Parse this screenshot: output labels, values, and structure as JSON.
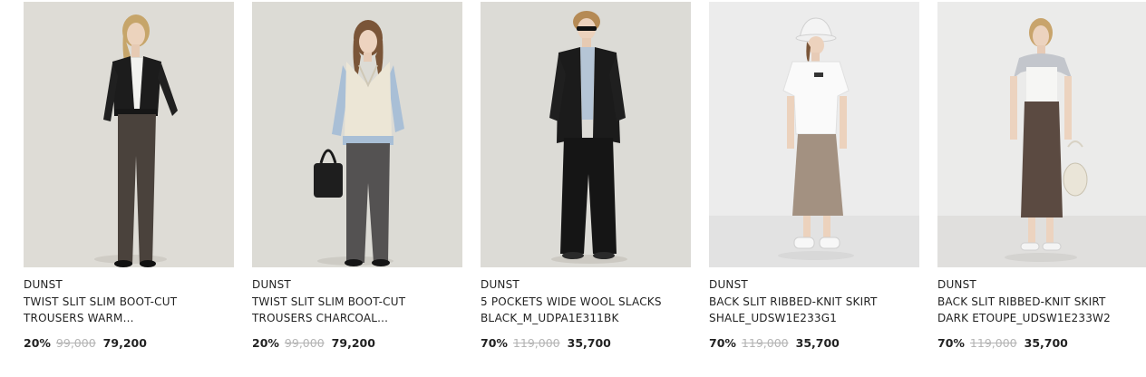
{
  "products": [
    {
      "brand": "DUNST",
      "name": "TWIST SLIT SLIM BOOT-CUT\nTROUSERS WARM...",
      "discount": "20%",
      "original_price": "99,000",
      "sale_price": "79,200",
      "image_icon": "model-black-jacket-grey-trousers"
    },
    {
      "brand": "DUNST",
      "name": "TWIST SLIT SLIM BOOT-CUT\nTROUSERS CHARCOAL...",
      "discount": "20%",
      "original_price": "99,000",
      "sale_price": "79,200",
      "image_icon": "model-knit-vest-charcoal-trousers"
    },
    {
      "brand": "DUNST",
      "name": "5 POCKETS WIDE WOOL SLACKS\nBLACK_M_UDPA1E311BK",
      "discount": "70%",
      "original_price": "119,000",
      "sale_price": "35,700",
      "image_icon": "model-black-suit"
    },
    {
      "brand": "DUNST",
      "name": "BACK SLIT RIBBED-KNIT SKIRT\nSHALE_UDSW1E233G1",
      "discount": "70%",
      "original_price": "119,000",
      "sale_price": "35,700",
      "image_icon": "model-white-tee-beige-skirt"
    },
    {
      "brand": "DUNST",
      "name": "BACK SLIT RIBBED-KNIT SKIRT\nDARK ETOUPE_UDSW1E233W2",
      "discount": "70%",
      "original_price": "119,000",
      "sale_price": "35,700",
      "image_icon": "model-white-top-brown-skirt"
    }
  ],
  "colors": {
    "text": "#222222",
    "strike_price": "#b4b4b4",
    "photo_bg_warm": "#dcdad4",
    "photo_bg_white": "#ececec"
  }
}
